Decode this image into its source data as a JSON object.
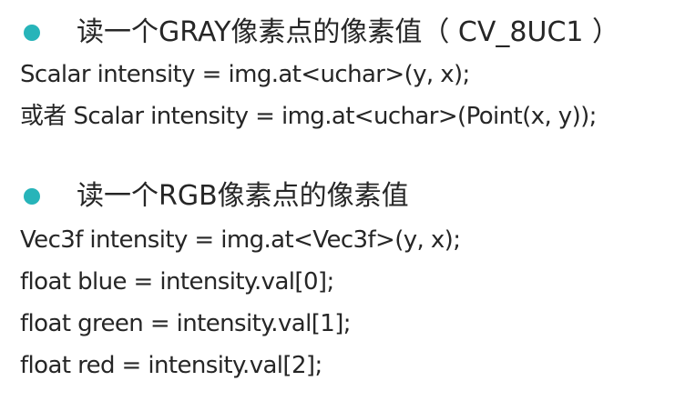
{
  "colors": {
    "bullet": "#27b4b9",
    "text": "#262626"
  },
  "section1": {
    "bullet_icon": "teal-dot-bullet",
    "heading": "读一个GRAY像素点的像素值（ CV_8UC1 ）",
    "lines": [
      "Scalar intensity = img.at<uchar>(y, x);",
      "或者 Scalar intensity = img.at<uchar>(Point(x, y));"
    ]
  },
  "section2": {
    "bullet_icon": "teal-dot-bullet",
    "heading": "读一个RGB像素点的像素值",
    "lines": [
      "Vec3f intensity = img.at<Vec3f>(y, x);",
      "float blue = intensity.val[0];",
      "float green = intensity.val[1];",
      "float red = intensity.val[2];"
    ]
  }
}
